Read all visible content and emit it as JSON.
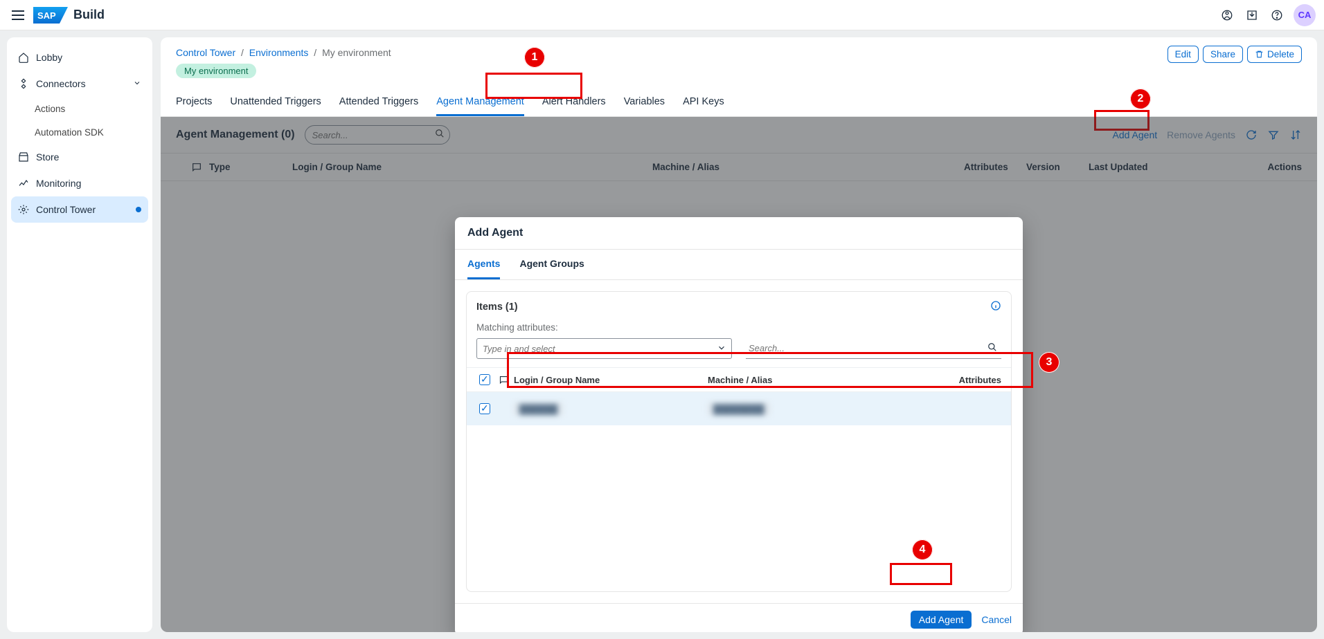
{
  "brand": "Build",
  "avatar": "CA",
  "sidebar": {
    "lobby": "Lobby",
    "connectors": "Connectors",
    "actions": "Actions",
    "sdk": "Automation SDK",
    "store": "Store",
    "monitoring": "Monitoring",
    "control_tower": "Control Tower"
  },
  "breadcrumb": {
    "a": "Control Tower",
    "b": "Environments",
    "c": "My environment"
  },
  "env_chip": "My environment",
  "header_actions": {
    "edit": "Edit",
    "share": "Share",
    "delete": "Delete"
  },
  "tabs": {
    "projects": "Projects",
    "unattended": "Unattended Triggers",
    "attended": "Attended Triggers",
    "agent_mgmt": "Agent Management",
    "alerts": "Alert Handlers",
    "vars": "Variables",
    "api_keys": "API Keys"
  },
  "toolbar": {
    "title": "Agent Management (0)",
    "search_placeholder": "Search...",
    "add_agent": "Add Agent",
    "remove_agents": "Remove Agents"
  },
  "grid": {
    "type": "Type",
    "login": "Login / Group Name",
    "machine": "Machine / Alias",
    "attributes": "Attributes",
    "version": "Version",
    "last_updated": "Last Updated",
    "actions": "Actions"
  },
  "dialog": {
    "title": "Add Agent",
    "tab_agents": "Agents",
    "tab_groups": "Agent Groups",
    "items_label": "Items (1)",
    "matching_label": "Matching attributes:",
    "combo_placeholder": "Type in and select",
    "search_placeholder": "Search...",
    "col_login": "Login / Group Name",
    "col_machine": "Machine / Alias",
    "col_attr": "Attributes",
    "row_login": "██████",
    "row_machine": "████████",
    "add_agent": "Add Agent",
    "cancel": "Cancel"
  },
  "annotations": {
    "a1": "1",
    "a2": "2",
    "a3": "3",
    "a4": "4"
  }
}
